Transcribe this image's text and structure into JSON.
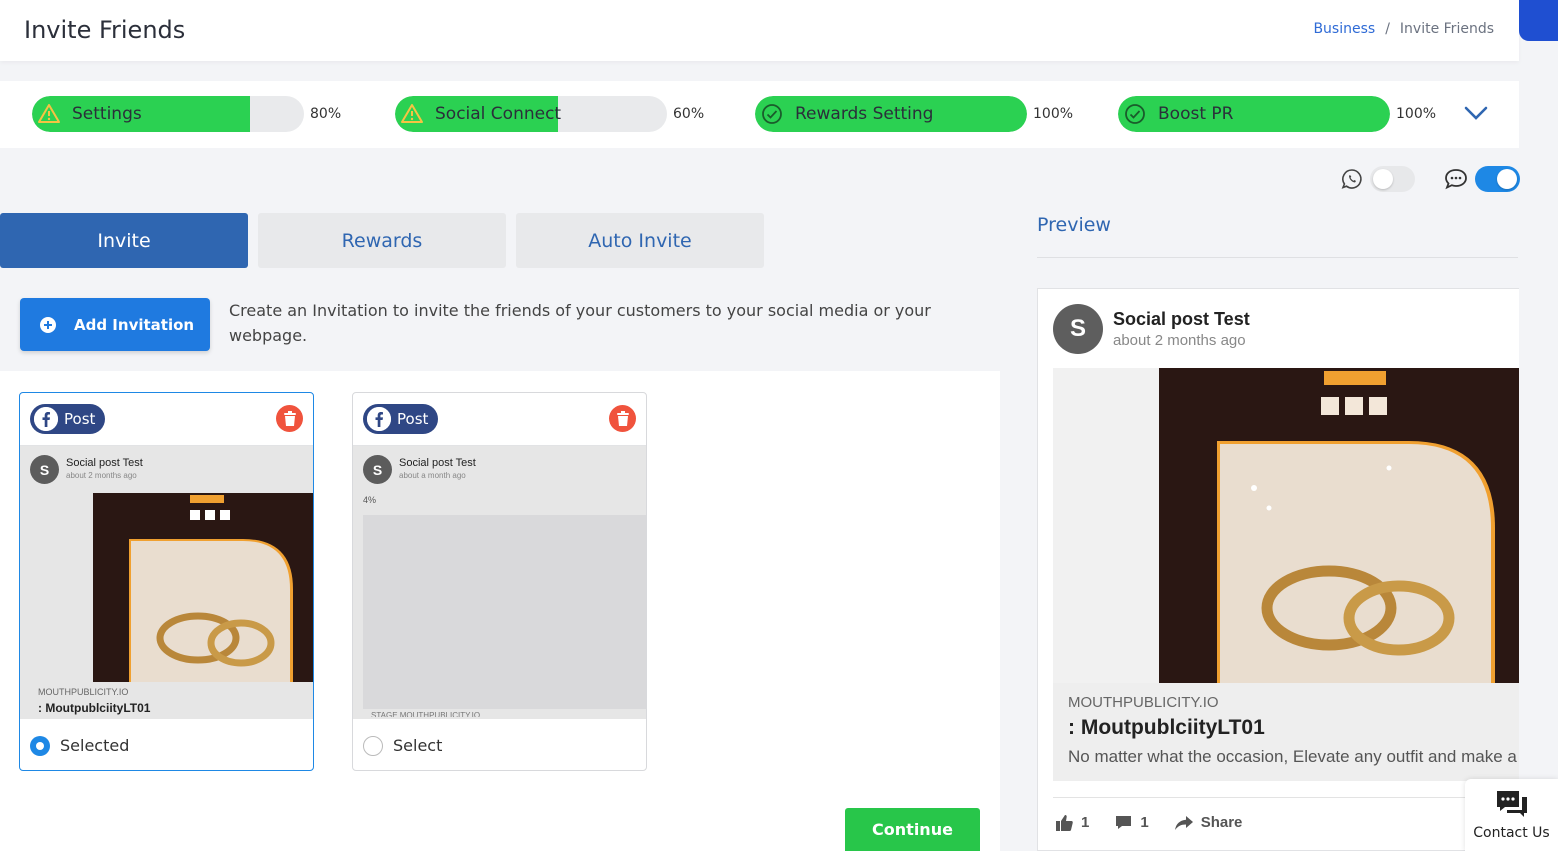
{
  "header": {
    "title": "Invite Friends",
    "breadcrumb": {
      "link": "Business",
      "separator": "/",
      "current": "Invite Friends"
    }
  },
  "progress": [
    {
      "label": "Settings",
      "percent_text": "80%",
      "fill": 0.8,
      "status": "warning"
    },
    {
      "label": "Social Connect",
      "percent_text": "60%",
      "fill": 0.6,
      "status": "warning"
    },
    {
      "label": "Rewards Setting",
      "percent_text": "100%",
      "fill": 1.0,
      "status": "done"
    },
    {
      "label": "Boost PR",
      "percent_text": "100%",
      "fill": 1.0,
      "status": "done"
    }
  ],
  "toggles": {
    "whatsapp": {
      "on": false
    },
    "sms": {
      "on": true
    }
  },
  "tabs": [
    {
      "label": "Invite",
      "active": true
    },
    {
      "label": "Rewards",
      "active": false
    },
    {
      "label": "Auto Invite",
      "active": false
    }
  ],
  "invite": {
    "add_button": "Add Invitation",
    "description": "Create an Invitation to invite the friends of your customers to your social media or your webpage."
  },
  "cards": [
    {
      "badge": "Post",
      "author": "Social post Test",
      "time": "about 2 months ago",
      "site": "MOUTHPUBLICITY.IO",
      "title": ": MoutpublciityLT01",
      "select_label": "Selected",
      "selected": true
    },
    {
      "badge": "Post",
      "author": "Social post Test",
      "time": "about a month ago",
      "percent": "4%",
      "cut_text": "STAGE.MOUTHPUBLICITY.IO",
      "select_label": "Select",
      "selected": false
    }
  ],
  "continue_label": "Continue",
  "preview": {
    "title": "Preview",
    "avatar_letter": "S",
    "author": "Social post Test",
    "time": "about 2 months ago",
    "site": "MOUTHPUBLICITY.IO",
    "link_title": ": MoutpublciityLT01",
    "link_desc": "No matter what the occasion, Elevate any outfit and make a",
    "likes": "1",
    "comments": "1",
    "share": "Share"
  },
  "avatar_letter": "S",
  "contact_label": "Contact Us",
  "colors": {
    "primary": "#2f66b1",
    "progress_fill": "#2bd152",
    "warning": "#f6c343",
    "danger": "#f0533d",
    "continue": "#28c64a",
    "facebook": "#2f4785"
  }
}
